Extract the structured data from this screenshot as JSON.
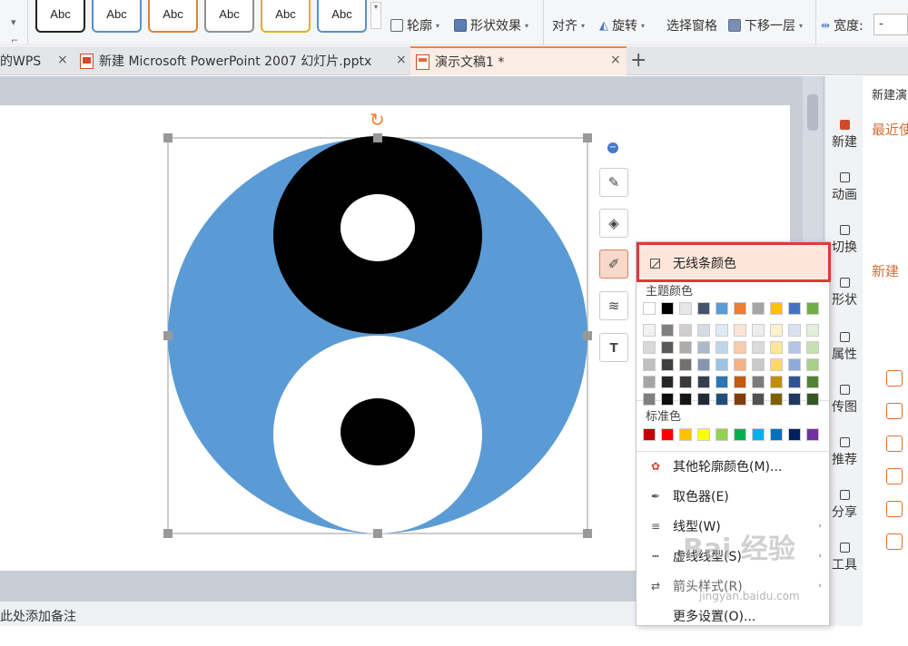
{
  "ribbon": {
    "style_tiles": [
      "Abc",
      "Abc",
      "Abc",
      "Abc",
      "Abc",
      "Abc"
    ],
    "style_tile_colors": [
      "#222222",
      "#5a8fc9",
      "#e0823a",
      "#909090",
      "#e0b020",
      "#5a8fc9"
    ],
    "outline": "轮廓",
    "shape_effect": "形状效果",
    "align": "对齐",
    "rotate": "旋转",
    "selection_pane": "选择窗格",
    "send_backward": "下移一层",
    "width_label": "宽度:",
    "width_value": "-"
  },
  "tabs": [
    {
      "label": "的WPS",
      "close": "×"
    },
    {
      "label": "新建 Microsoft PowerPoint 2007 幻灯片.pptx",
      "close": "×"
    },
    {
      "label": "演示文稿1 *",
      "close": "×"
    }
  ],
  "add_tab": "+",
  "notes_placeholder": "此处添加备注",
  "float_tools": [
    "edit-shape",
    "fill",
    "outline",
    "layers",
    "text-format"
  ],
  "right_nav": [
    {
      "label": "新建",
      "icon": "new-doc-icon"
    },
    {
      "label": "动画",
      "icon": "animation-icon"
    },
    {
      "label": "切换",
      "icon": "transition-icon"
    },
    {
      "label": "形状",
      "icon": "shape-icon"
    },
    {
      "label": "属性",
      "icon": "property-icon"
    },
    {
      "label": "传图",
      "icon": "upload-image-icon"
    },
    {
      "label": "推荐",
      "icon": "recommend-icon"
    },
    {
      "label": "分享",
      "icon": "share-icon"
    },
    {
      "label": "工具",
      "icon": "tools-icon"
    }
  ],
  "right_panel": {
    "title": "新建演",
    "recent": "最近使",
    "new": "新建"
  },
  "menu": {
    "no_line_color": "无线条颜色",
    "theme_colors_label": "主题颜色",
    "standard_colors_label": "标准色",
    "theme_top_row": [
      "#ffffff",
      "#000000",
      "#e7e6e6",
      "#44546a",
      "#5b9bd5",
      "#ed7d31",
      "#a5a5a5",
      "#ffc000",
      "#4472c4",
      "#70ad47"
    ],
    "theme_shades": [
      [
        "#f2f2f2",
        "#7f7f7f",
        "#d0cece",
        "#d6dce4",
        "#deebf6",
        "#fbe4d5",
        "#ededed",
        "#fff2cc",
        "#d9e2f3",
        "#e2efd9"
      ],
      [
        "#d8d8d8",
        "#595959",
        "#aeabab",
        "#adb9ca",
        "#bdd7ee",
        "#f7cbac",
        "#dbdbdb",
        "#fee599",
        "#b4c6e7",
        "#c5e0b3"
      ],
      [
        "#bfbfbf",
        "#3f3f3f",
        "#757070",
        "#8496b0",
        "#9cc3e5",
        "#f4b183",
        "#c9c9c9",
        "#ffd965",
        "#8eaadb",
        "#a8d08d"
      ],
      [
        "#a5a5a5",
        "#262626",
        "#3a3838",
        "#323f4f",
        "#2e75b5",
        "#c55a11",
        "#7b7b7b",
        "#bf9000",
        "#2f5496",
        "#538135"
      ],
      [
        "#7f7f7f",
        "#0c0c0c",
        "#171616",
        "#222a35",
        "#1e4e79",
        "#833c0b",
        "#525252",
        "#7f6000",
        "#1f3864",
        "#375623"
      ]
    ],
    "standard_colors": [
      "#c00000",
      "#ff0000",
      "#ffc000",
      "#ffff00",
      "#92d050",
      "#00b050",
      "#00b0f0",
      "#0070c0",
      "#002060",
      "#7030a0"
    ],
    "items": [
      {
        "label": "其他轮廓颜色(M)...",
        "icon": "palette-icon",
        "arrow": ""
      },
      {
        "label": "取色器(E)",
        "icon": "eyedropper-icon",
        "arrow": ""
      },
      {
        "label": "线型(W)",
        "icon": "line-weight-icon",
        "arrow": "›"
      },
      {
        "label": "虚线线型(S)",
        "icon": "dash-icon",
        "arrow": "›"
      },
      {
        "label": "箭头样式(R)",
        "icon": "arrow-style-icon",
        "arrow": "›"
      },
      {
        "label": "更多设置(O)...",
        "icon": "",
        "arrow": ""
      }
    ]
  },
  "watermark": "Bai 经验",
  "watermark_url": "jingyan.baidu.com",
  "colors": {
    "accent": "#f08040",
    "highlight_border": "#e0383a",
    "circle_blue": "#5b9bd5"
  }
}
